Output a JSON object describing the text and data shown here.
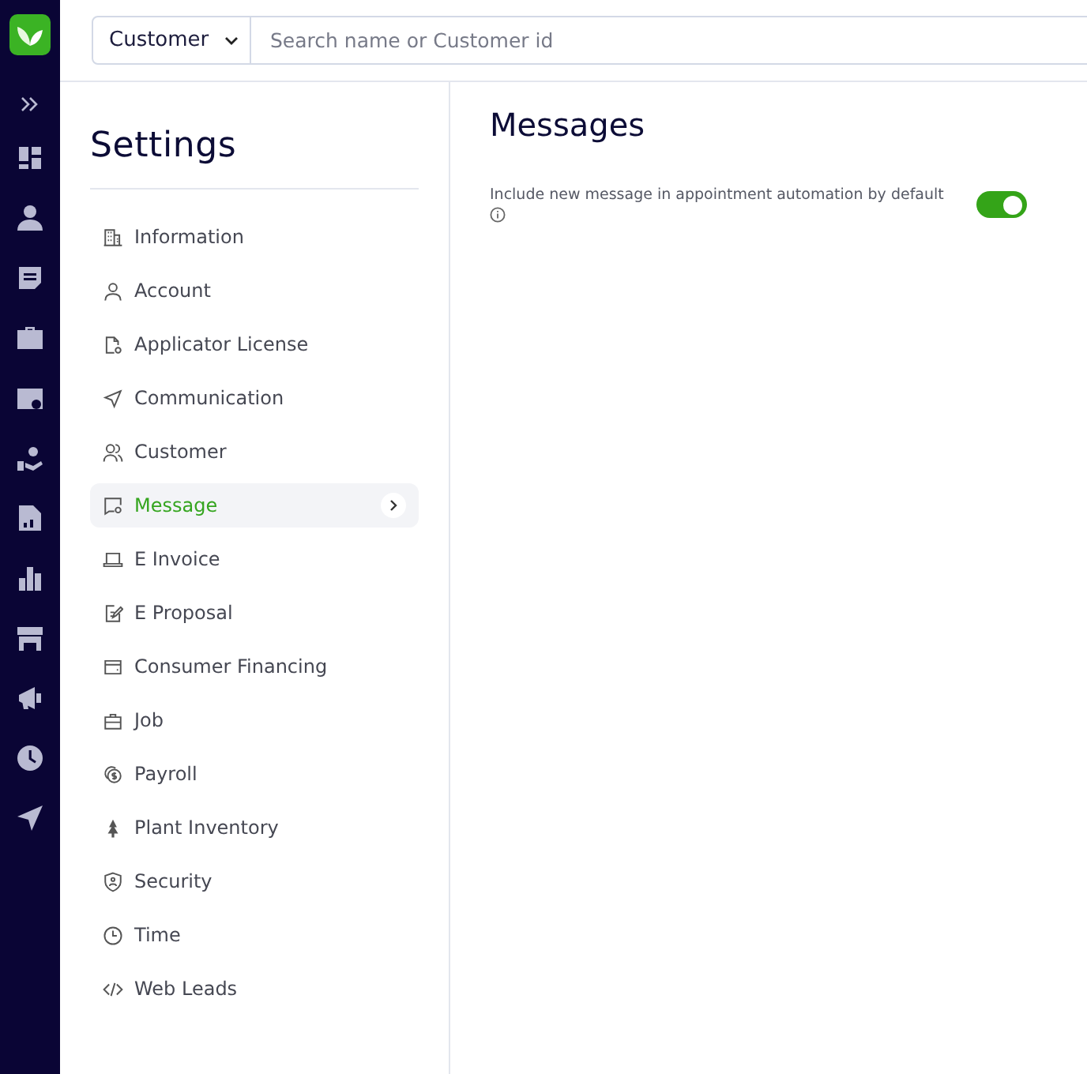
{
  "search": {
    "category": "Customer",
    "placeholder": "Search name or Customer id"
  },
  "settings": {
    "title": "Settings",
    "items": [
      {
        "label": "Information",
        "selected": false
      },
      {
        "label": "Account",
        "selected": false
      },
      {
        "label": "Applicator License",
        "selected": false
      },
      {
        "label": "Communication",
        "selected": false
      },
      {
        "label": "Customer",
        "selected": false
      },
      {
        "label": "Message",
        "selected": true
      },
      {
        "label": "E Invoice",
        "selected": false
      },
      {
        "label": "E Proposal",
        "selected": false
      },
      {
        "label": "Consumer Financing",
        "selected": false
      },
      {
        "label": "Job",
        "selected": false
      },
      {
        "label": "Payroll",
        "selected": false
      },
      {
        "label": "Plant Inventory",
        "selected": false
      },
      {
        "label": "Security",
        "selected": false
      },
      {
        "label": "Time",
        "selected": false
      },
      {
        "label": "Web Leads",
        "selected": false
      }
    ]
  },
  "content": {
    "title": "Messages",
    "options": [
      {
        "kind": "toggle",
        "label": "Include new message in appointment automation by default",
        "on": true
      }
    ]
  }
}
